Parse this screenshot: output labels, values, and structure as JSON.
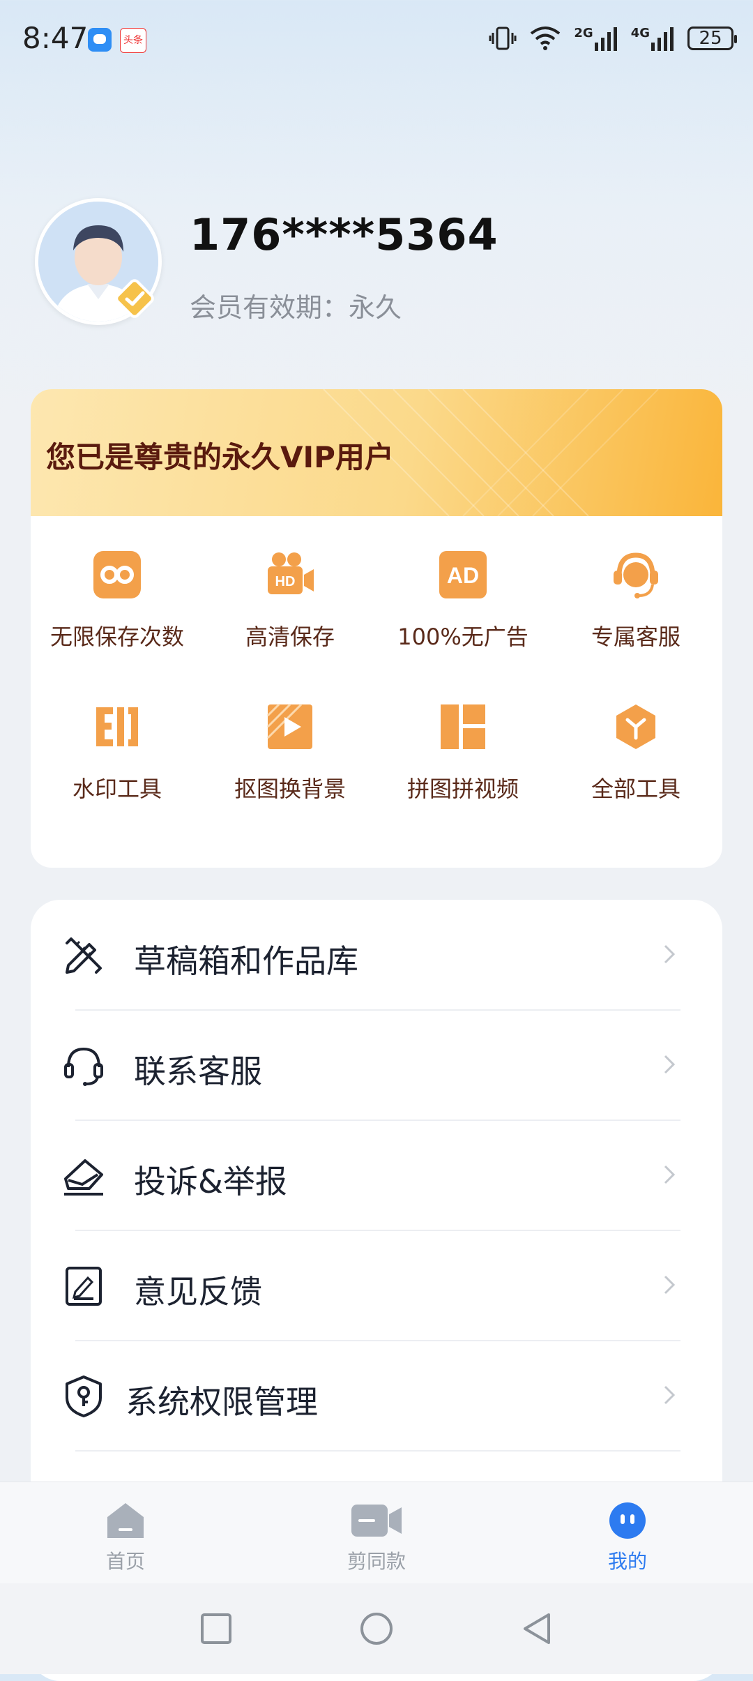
{
  "status_bar": {
    "time": "8:47",
    "notification_2_text": "头条",
    "network_2g": "2G",
    "network_4g": "4G",
    "battery": "25"
  },
  "profile": {
    "phone": "176****5364",
    "membership_validity": "会员有效期：永久"
  },
  "vip_card": {
    "title": "您已是尊贵的永久VIP用户",
    "features": [
      {
        "label": "无限保存次数",
        "icon": "infinity-icon"
      },
      {
        "label": "高清保存",
        "icon": "hd-camera-icon"
      },
      {
        "label": "100%无广告",
        "icon": "ad-free-icon"
      },
      {
        "label": "专属客服",
        "icon": "headset-agent-icon"
      },
      {
        "label": "水印工具",
        "icon": "watermark-icon"
      },
      {
        "label": "抠图换背景",
        "icon": "cutout-icon"
      },
      {
        "label": "拼图拼视频",
        "icon": "collage-icon"
      },
      {
        "label": "全部工具",
        "icon": "all-tools-icon"
      }
    ],
    "accent_color": "#f3a04a"
  },
  "menu": {
    "items": [
      {
        "label": "草稿箱和作品库",
        "icon": "pencil-ruler-icon"
      },
      {
        "label": "联系客服",
        "icon": "headset-icon"
      },
      {
        "label": "投诉&举报",
        "icon": "report-envelope-icon"
      },
      {
        "label": "意见反馈",
        "icon": "feedback-edit-icon"
      },
      {
        "label": "系统权限管理",
        "icon": "shield-key-icon"
      }
    ]
  },
  "tabs": [
    {
      "label": "首页",
      "icon": "home-icon",
      "active": false
    },
    {
      "label": "剪同款",
      "icon": "video-camera-icon",
      "active": false
    },
    {
      "label": "我的",
      "icon": "profile-face-icon",
      "active": true
    }
  ],
  "colors": {
    "tab_active": "#2d7bf0",
    "tab_inactive": "#9aa0a8"
  }
}
